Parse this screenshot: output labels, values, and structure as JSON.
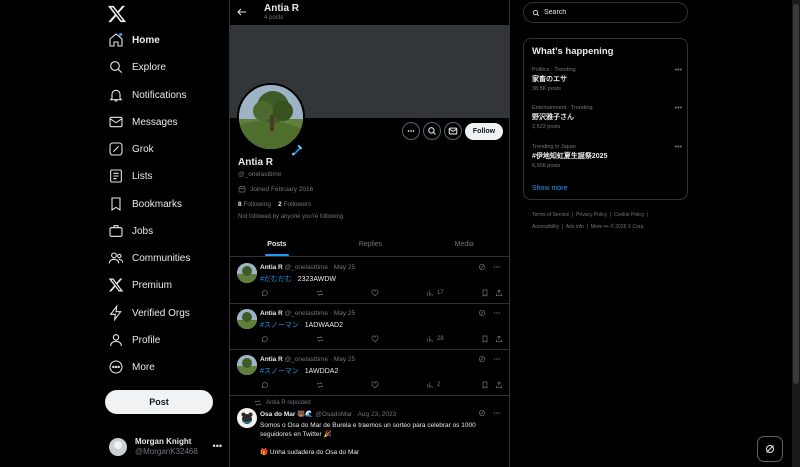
{
  "nav": {
    "items": [
      {
        "label": "Home",
        "icon": "home-icon"
      },
      {
        "label": "Explore",
        "icon": "search-icon"
      },
      {
        "label": "Notifications",
        "icon": "bell-icon"
      },
      {
        "label": "Messages",
        "icon": "envelope-icon"
      },
      {
        "label": "Grok",
        "icon": "grok-icon"
      },
      {
        "label": "Lists",
        "icon": "list-icon"
      },
      {
        "label": "Bookmarks",
        "icon": "bookmark-icon"
      },
      {
        "label": "Jobs",
        "icon": "briefcase-icon"
      },
      {
        "label": "Communities",
        "icon": "people-icon"
      },
      {
        "label": "Premium",
        "icon": "x-logo-icon"
      },
      {
        "label": "Verified Orgs",
        "icon": "lightning-icon"
      },
      {
        "label": "Profile",
        "icon": "person-icon"
      },
      {
        "label": "More",
        "icon": "more-circle-icon"
      }
    ],
    "post_button": "Post"
  },
  "account": {
    "name": "Morgan Knight",
    "handle": "@MorganK32468"
  },
  "profile": {
    "top_name": "Antia R",
    "post_count": "4 posts",
    "name": "Antia R",
    "handle": "@_onelasttime",
    "joined": "Joined February 2016",
    "following_count": "8",
    "following_label": "Following",
    "followers_count": "2",
    "followers_label": "Followers",
    "note": "Not followed by anyone you're following",
    "follow_button": "Follow"
  },
  "tabs": [
    "Posts",
    "Replies",
    "Media"
  ],
  "posts": [
    {
      "name": "Antia R",
      "meta": "@_onelasttime · May 25",
      "hashtag": "#だむだむ",
      "text": "2323AWDW",
      "views": "17"
    },
    {
      "name": "Antia R",
      "meta": "@_onelasttime · May 25",
      "hashtag": "#スノーマン",
      "text": "1ADWAAD2",
      "views": "28"
    },
    {
      "name": "Antia R",
      "meta": "@_onelasttime · May 25",
      "hashtag": "#スノーマン",
      "text": "1AWDDA2",
      "views": "2"
    }
  ],
  "repost": {
    "label": "Antia R reposted",
    "name": "Osa do Mar",
    "name_emoji": "🐻🌊",
    "meta": "@OsadoMar · Aug 23, 2023",
    "line1": "Somos o Osa do Mar de Burela e traemos un sorteo para celebrar os 1000",
    "line2": "seguidores en Twitter 🎉",
    "line3": "🎁 Unha sudadera do Osa do Mar"
  },
  "search": {
    "placeholder": "Search"
  },
  "trends": {
    "title": "What's happening",
    "items": [
      {
        "category": "Politics · Trending",
        "topic": "家畜のエサ",
        "posts": "38.5K posts"
      },
      {
        "category": "Entertainment · Trending",
        "topic": "野沢雅子さん",
        "posts": "2,522 posts"
      },
      {
        "category": "Trending in Japan",
        "topic": "#伊地知虹夏生誕祭2025",
        "posts": "6,606 posts"
      }
    ],
    "show_more": "Show more"
  },
  "footer": {
    "terms": "Terms of Service",
    "privacy": "Privacy Policy",
    "cookie": "Cookie Policy",
    "accessibility": "Accessibility",
    "ads": "Ads info",
    "more": "More",
    "corp": "© 2025 X Corp."
  },
  "colors": {
    "accent": "#1d9bf0",
    "background": "#000000",
    "border": "#2f3336",
    "muted": "#71767b"
  }
}
